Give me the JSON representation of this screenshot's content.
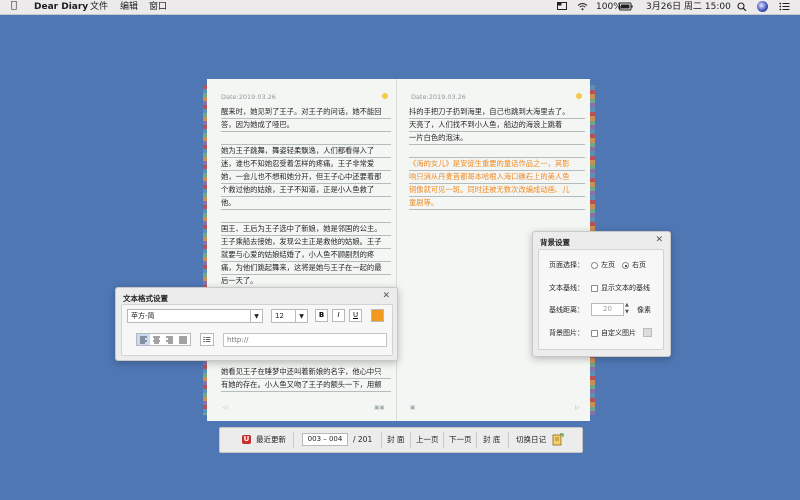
{
  "menubar": {
    "app_name": "Dear Diary",
    "menus": [
      "文件",
      "编辑",
      "窗口"
    ],
    "battery": "100%",
    "datetime": "3月26日 周二  15:00"
  },
  "book": {
    "left_page": {
      "date": "Date:2019.03.26",
      "lines": [
        "醒来时，她见到了王子。对王子的问话，她不能回",
        "答，因为她成了哑巴。",
        "",
        "她为王子跳舞，舞姿轻柔飘逸，人们都看得入了",
        "迷，谁也不知她忍受着怎样的疼痛。王子非常爱",
        "她，一会儿也不想和她分开，但王子心中还要着那",
        "个救过他的姑娘，王子不知道，正是小人鱼救了",
        "他。",
        "",
        " 国王、王后为王子选中了新娘，她是邻国的公主。",
        "王子乘船去接她，发现公主正是救他的姑娘。王子",
        "就要与心爱的姑娘结婚了，小人鱼不顾剧烈的疼",
        "痛，为他们跳起舞来，这将是她与王子在一起的最",
        "后一天了。"
      ],
      "bottom_lines": [
        "她看见王子在睡梦中还叫着新娘的名字，他心中只",
        "有她的存在。小人鱼又吻了王子的额头一下，用颤"
      ]
    },
    "right_page": {
      "date": "Date:2019.03.26",
      "lines": [
        "抖的手把刀子扔到海里，自己也跳到大海里去了。",
        "天亮了，人们找不到小人鱼，船边的海浪上跳着",
        "一片白色的泡沫。"
      ],
      "note_lines": [
        "《海的女儿》是安徒生重要的童话作品之一，其影",
        "响只消从丹麦首都哥本哈根入海口礁石上的美人鱼",
        "铜像就可见一斑。同时还被无数次改编成动画、儿",
        "童剧等。"
      ]
    }
  },
  "text_format_panel": {
    "title": "文本格式设置",
    "font_value": "苹方-简",
    "size_value": "12",
    "bold_label": "B",
    "italic_label": "I",
    "underline_label": "U",
    "color_swatch": "#f39a1e",
    "link_placeholder": "http://"
  },
  "background_panel": {
    "title": "背景设置",
    "page_select_label": "页面选择：",
    "option_left": "左页",
    "option_right": "右页",
    "selected_option": "右页",
    "baseline_label": "文本基线：",
    "baseline_checkbox_label": "显示文本的基线",
    "baseline_distance_label": "基线距离：",
    "baseline_distance_value": "20",
    "distance_unit": "像素",
    "bg_image_label": "背景图片：",
    "bg_image_checkbox_label": "自定义图片"
  },
  "toolbar": {
    "recent_update": "最近更新",
    "page_range": "003 – 004",
    "page_total": "/ 201",
    "cover": "封 面",
    "prev": "上一页",
    "next": "下一页",
    "back_cover": "封 底",
    "switch_diary": "切换日记"
  },
  "colors": {
    "desktop": "#4f77b4",
    "accent_orange": "#f08a24"
  }
}
